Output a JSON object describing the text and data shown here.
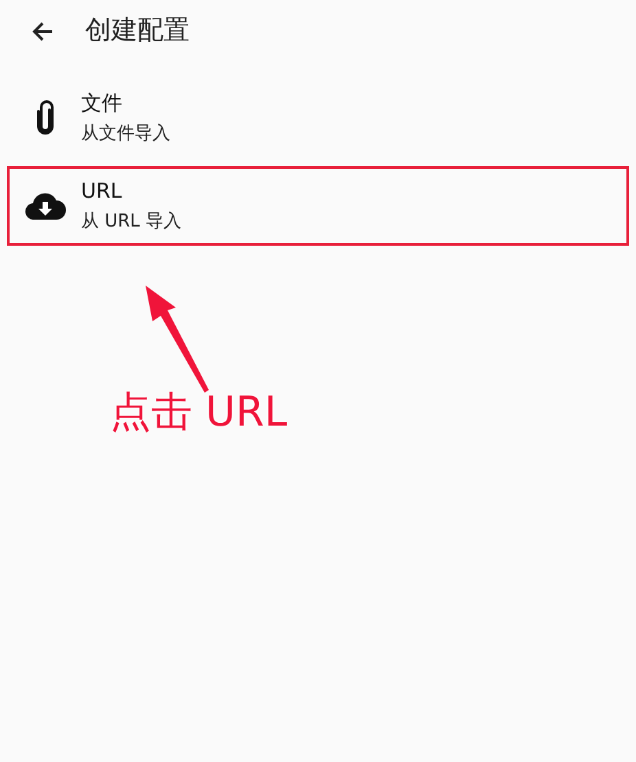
{
  "header": {
    "title": "创建配置"
  },
  "items": [
    {
      "kind": "file",
      "title": "文件",
      "subtitle": "从文件导入",
      "highlighted": false
    },
    {
      "kind": "url",
      "title": "URL",
      "subtitle": "从 URL 导入",
      "highlighted": true
    }
  ],
  "annotation": {
    "text": "点击 URL"
  }
}
